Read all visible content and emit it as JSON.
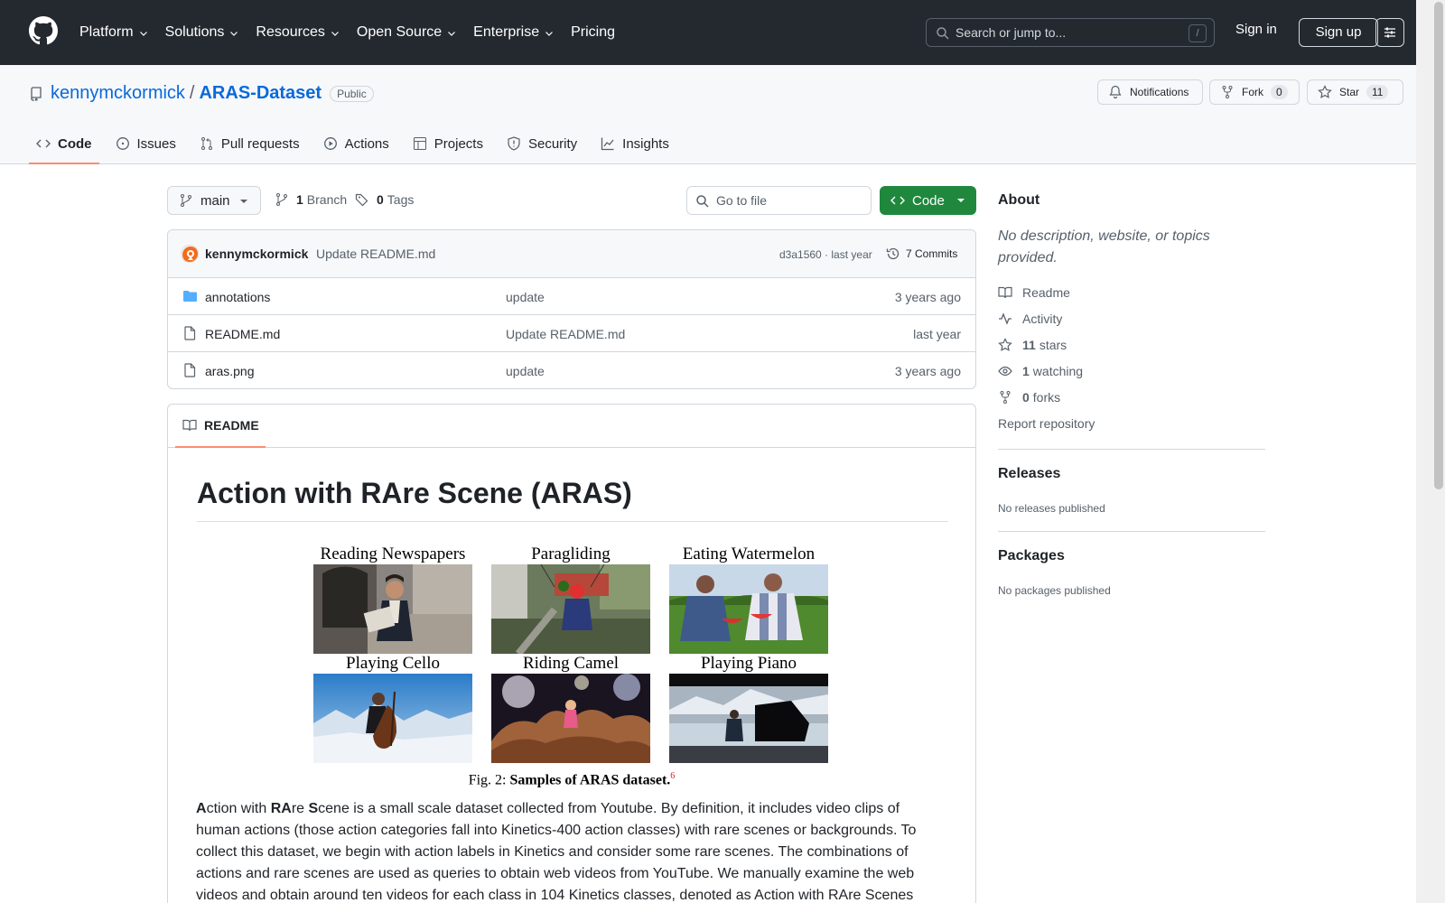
{
  "header": {
    "nav": [
      "Platform",
      "Solutions",
      "Resources",
      "Open Source",
      "Enterprise",
      "Pricing"
    ],
    "search_placeholder": "Search or jump to...",
    "search_shortcut": "/",
    "signin": "Sign in",
    "signup": "Sign up"
  },
  "repo": {
    "owner": "kennymckormick",
    "separator": "/",
    "name": "ARAS-Dataset",
    "visibility": "Public",
    "notifications_label": "Notifications",
    "fork_label": "Fork",
    "fork_count": "0",
    "star_label": "Star",
    "star_count": "11",
    "tabs": [
      "Code",
      "Issues",
      "Pull requests",
      "Actions",
      "Projects",
      "Security",
      "Insights"
    ]
  },
  "toolbar": {
    "branch": "main",
    "branch_count": "1",
    "branch_label": "Branch",
    "tag_count": "0",
    "tag_label": "Tags",
    "goto_placeholder": "Go to file",
    "code_label": "Code"
  },
  "commit": {
    "author": "kennymckormick",
    "message": "Update README.md",
    "hash_time": "d3a1560 · last year",
    "commits": "7 Commits"
  },
  "files": [
    {
      "name": "annotations",
      "type": "folder",
      "message": "update",
      "date": "3 years ago"
    },
    {
      "name": "README.md",
      "type": "file",
      "message": "Update README.md",
      "date": "last year"
    },
    {
      "name": "aras.png",
      "type": "file",
      "message": "update",
      "date": "3 years ago"
    }
  ],
  "readme": {
    "tab": "README",
    "title": "Action with RAre Scene (ARAS)",
    "figure_labels": [
      "Reading Newspapers",
      "Paragliding",
      "Eating Watermelon",
      "Playing Cello",
      "Riding Camel",
      "Playing Piano"
    ],
    "caption_prefix": "Fig. 2: ",
    "caption_bold": "Samples of ARAS dataset.",
    "caption_sup": "6",
    "body_a": "A",
    "body_1": "ction with ",
    "body_ra": "RA",
    "body_2": "re ",
    "body_s": "S",
    "body_3": "cene is a small scale dataset collected from Youtube. By definition, it includes video clips of human actions (those action categories fall into Kinetics-400 action classes) with rare scenes or backgrounds. To collect this dataset, we begin with action labels in Kinetics and consider some rare scenes. The combinations of actions and rare scenes are used as queries to obtain web videos from YouTube. We manually examine the web videos and obtain around ten videos for each class in 104 Kinetics classes, denoted as Action with RAre Scenes"
  },
  "sidebar": {
    "about_title": "About",
    "about_desc": "No description, website, or topics provided.",
    "readme": "Readme",
    "activity": "Activity",
    "stars_count": "11",
    "stars_label": "stars",
    "watching_count": "1",
    "watching_label": "watching",
    "forks_count": "0",
    "forks_label": "forks",
    "report": "Report repository",
    "releases_title": "Releases",
    "releases_sub": "No releases published",
    "packages_title": "Packages",
    "packages_sub": "No packages published"
  }
}
